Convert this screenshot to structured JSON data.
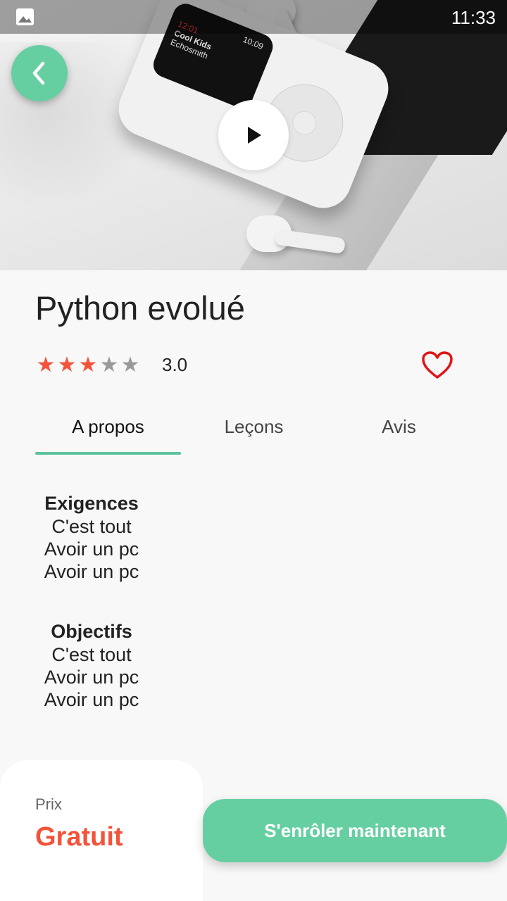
{
  "status_bar": {
    "time": "11:33"
  },
  "hero": {
    "device_screen_time": "10:09",
    "device_track": "Cool Kids",
    "device_artist": "Echosmith",
    "device_elapsed": "12:01"
  },
  "course": {
    "title": "Python evolué",
    "rating": "3.0",
    "rating_stars": 3,
    "rating_max": 5
  },
  "tabs": [
    {
      "label": "A propos",
      "active": true
    },
    {
      "label": "Leçons",
      "active": false
    },
    {
      "label": "Avis",
      "active": false
    }
  ],
  "sections": {
    "requirements": {
      "heading": "Exigences",
      "items": [
        "C'est tout",
        "Avoir un pc",
        "Avoir un pc"
      ]
    },
    "objectives": {
      "heading": "Objectifs",
      "items": [
        "C'est tout",
        "Avoir un pc",
        "Avoir un pc"
      ]
    }
  },
  "footer": {
    "price_label": "Prix",
    "price_value": "Gratuit",
    "enroll_label": "S'enrôler maintenant"
  },
  "colors": {
    "accent": "#66cfa2",
    "price": "#f3533a",
    "star_on": "#f3533a",
    "star_off": "#999999",
    "heart": "#e01515"
  }
}
